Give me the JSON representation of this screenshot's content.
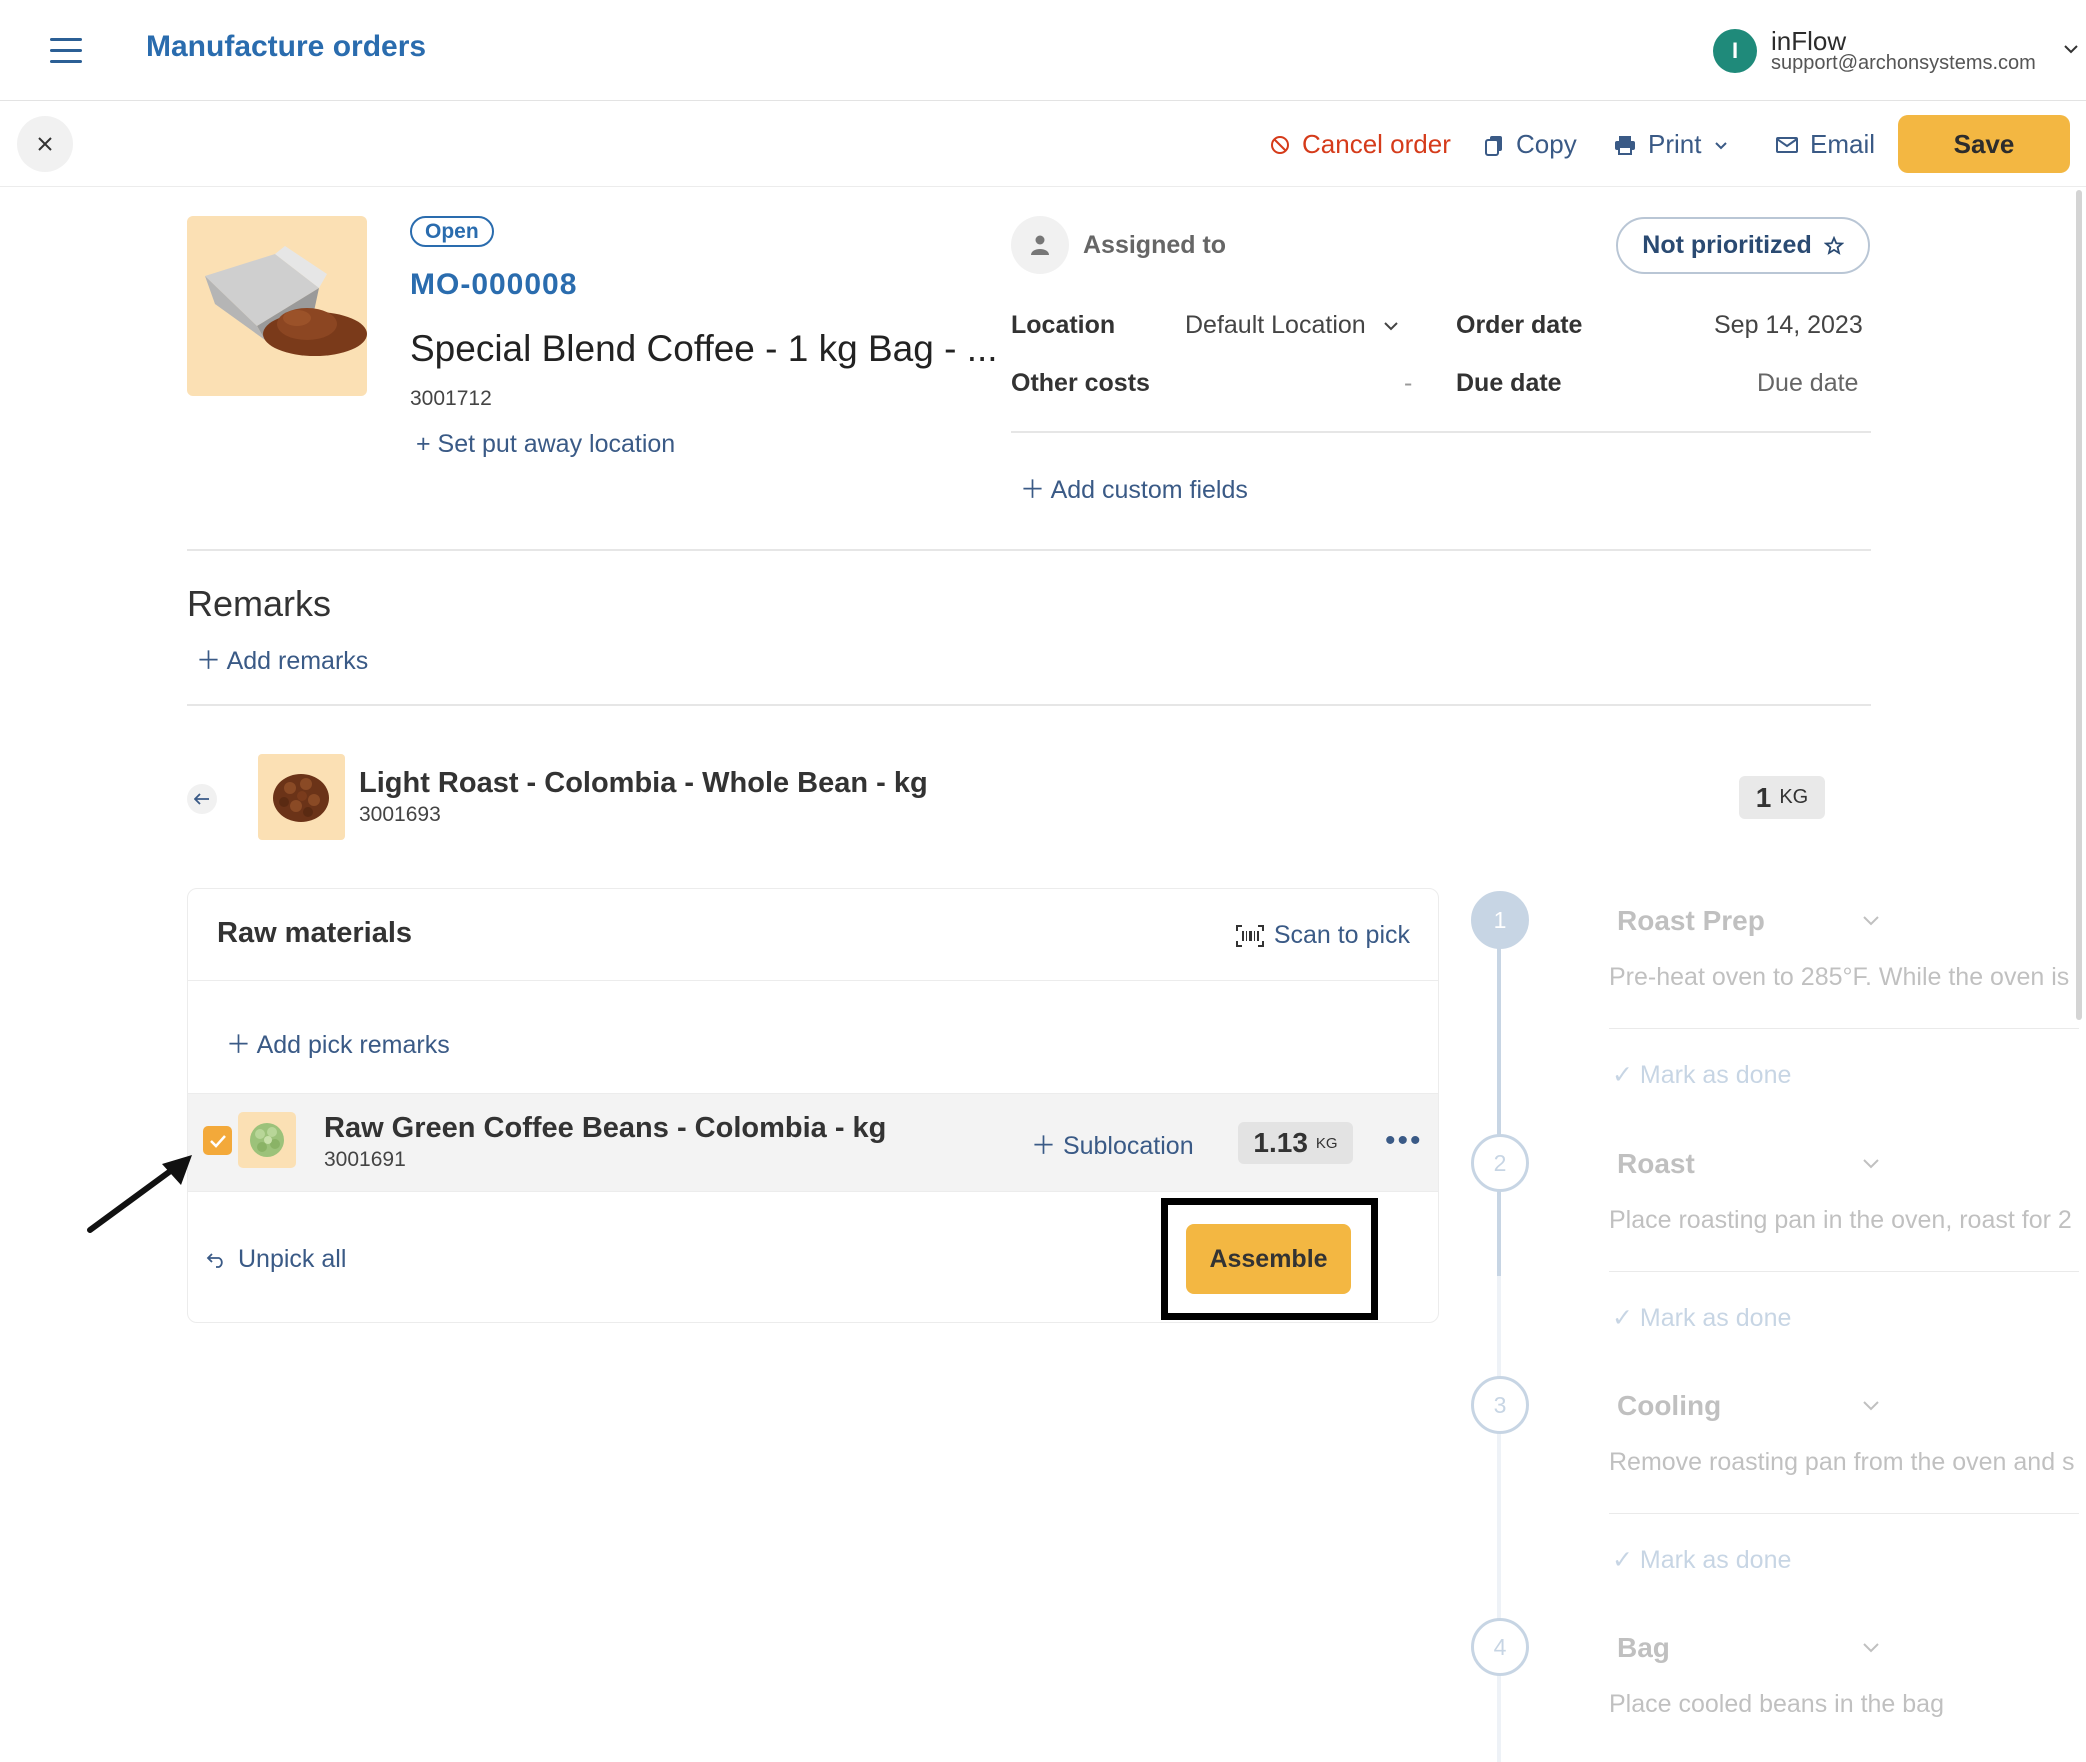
{
  "header": {
    "title": "Manufacture orders",
    "account_initial": "I",
    "company": "inFlow",
    "email": "support@archonsystems.com"
  },
  "toolbar": {
    "cancel_order": "Cancel order",
    "copy": "Copy",
    "print": "Print",
    "email": "Email",
    "save": "Save"
  },
  "order": {
    "status": "Open",
    "number": "MO-000008",
    "product_name": "Special Blend Coffee - 1 kg Bag - ...",
    "sku": "3001712",
    "put_away": "+ Set put away location",
    "assigned_to": "Assigned to",
    "priority": "Not prioritized",
    "location_label": "Location",
    "location_value": "Default Location",
    "other_costs_label": "Other costs",
    "other_costs_value": "-",
    "order_date_label": "Order date",
    "order_date_value": "Sep 14, 2023",
    "due_date_label": "Due date",
    "due_date_value": "Due date",
    "add_custom_fields": "Add custom fields"
  },
  "remarks": {
    "heading": "Remarks",
    "add": "Add remarks"
  },
  "finished_product": {
    "name": "Light Roast - Colombia - Whole Bean - kg",
    "sku": "3001693",
    "qty": "1",
    "unit": "KG"
  },
  "raw_materials": {
    "title": "Raw materials",
    "scan_to_pick": "Scan to pick",
    "add_pick_remarks": "Add pick remarks",
    "items": [
      {
        "name": "Raw Green Coffee Beans - Colombia - kg",
        "sku": "3001691",
        "sublocation": "Sublocation",
        "qty": "1.13",
        "unit": "KG",
        "checked": true
      }
    ],
    "unpick_all": "Unpick all",
    "assemble": "Assemble"
  },
  "steps": [
    {
      "number": "1",
      "name": "Roast Prep",
      "description": "Pre-heat oven to 285°F. While the oven is",
      "done_label": "Mark as done"
    },
    {
      "number": "2",
      "name": "Roast",
      "description": "Place roasting pan in the oven, roast for 2",
      "done_label": "Mark as done"
    },
    {
      "number": "3",
      "name": "Cooling",
      "description": "Remove roasting pan from the oven and s",
      "done_label": "Mark as done"
    },
    {
      "number": "4",
      "name": "Bag",
      "description": "Place cooled beans in the bag",
      "done_label": ""
    }
  ],
  "colors": {
    "brand_blue": "#2a6cae",
    "accent_yellow": "#f3b742",
    "danger_red": "#d53b1a",
    "avatar_teal": "#1f8a7a"
  }
}
